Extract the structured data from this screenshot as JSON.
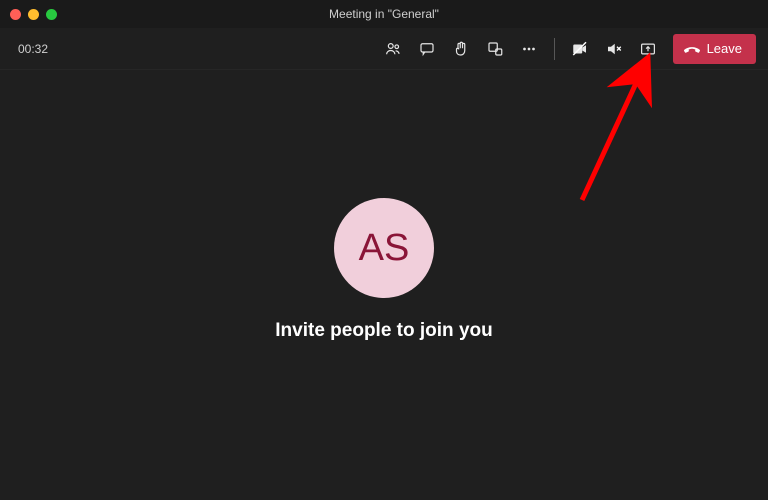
{
  "window": {
    "title": "Meeting in \"General\""
  },
  "toolbar": {
    "timer": "00:32",
    "leave_label": "Leave"
  },
  "participant": {
    "initials": "AS"
  },
  "main": {
    "invite_text": "Invite people to join you"
  },
  "colors": {
    "leave_button": "#c4314b",
    "avatar_bg": "#f1cfdb",
    "avatar_text": "#8a1538",
    "arrow": "#ff0000"
  },
  "icons": {
    "people": "people-icon",
    "chat": "chat-icon",
    "raise_hand": "raise-hand-icon",
    "breakout": "breakout-rooms-icon",
    "more": "more-icon",
    "camera_off": "camera-off-icon",
    "mic_off": "audio-off-icon",
    "share": "share-screen-icon",
    "hangup": "hangup-icon"
  }
}
